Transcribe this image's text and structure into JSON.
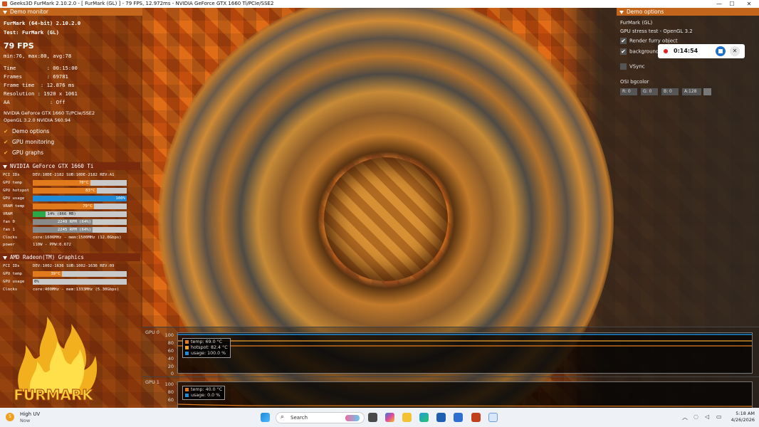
{
  "window": {
    "title": "Geeks3D FurMark 2.10.2.0 - [ FurMark (GL) ] - 79 FPS, 12.972ms - NVIDIA GeForce GTX 1660 Ti/PCIe/SSE2",
    "controls": [
      "—",
      "☐",
      "✕"
    ]
  },
  "demo_monitor": {
    "header": "Demo monitor",
    "app_line": "FurMark (64-bit) 2.10.2.0",
    "test_line": "Test: FurMark (GL)",
    "fps": "79 FPS",
    "minmax": "min:76, max:80, avg:78",
    "stats": [
      "Time          : 00:15:00",
      "Frames        : 69781",
      "Frame time  : 12.876 ms",
      "Resolution : 1920 x 1061",
      "AA             : Off"
    ],
    "gpu_name": "NVIDIA GeForce GTX 1660 Ti/PCIe/SSE2",
    "opengl": "OpenGL 3.2.0 NVIDIA 560.94",
    "checks": [
      "Demo options",
      "GPU monitoring",
      "GPU graphs"
    ]
  },
  "gpu0": {
    "header": "NVIDIA GeForce GTX 1660 Ti",
    "pci_label": "PCI IDs",
    "pci_value": "DEV:10DE-2182 SUB:10DE-2182 REV:A1",
    "bars": [
      {
        "label": "GPU temp",
        "text": "70°C",
        "percent": 61,
        "color": "#e07a1c"
      },
      {
        "label": "GPU hotspot",
        "text": "83°C",
        "percent": 68,
        "color": "#e07a1c"
      },
      {
        "label": "GPU usage",
        "text": "100%",
        "percent": 100,
        "color": "#1f8ad6"
      },
      {
        "label": "VRAM temp",
        "text": "79°C",
        "percent": 65,
        "color": "#e07a1c"
      },
      {
        "label": "VRAM",
        "text": "14% (866 MB)",
        "percent": 14,
        "color": "#2aa84a"
      },
      {
        "label": "fan 0",
        "text": "2249 RPM (64%)",
        "percent": 64,
        "color": "#8a8a8a"
      },
      {
        "label": "fan 1",
        "text": "2245 RPM (64%)",
        "percent": 64,
        "color": "#8a8a8a"
      }
    ],
    "clocks_label": "Clocks",
    "clocks_value": "core:1606MHz - mem:1500MHz (12.0Gbps)",
    "power_label": "power",
    "power_value": "110W - PPW:0.672"
  },
  "gpu1": {
    "header": "AMD Radeon(TM) Graphics",
    "pci_label": "PCI IDs",
    "pci_value": "DEV:1002-1636 SUB:1002-1636 REV:09",
    "bars": [
      {
        "label": "GPU temp",
        "text": "39°C",
        "percent": 31,
        "color": "#e07a1c"
      },
      {
        "label": "GPU usage",
        "text": "0%",
        "percent": 0,
        "color": "#1f8ad6"
      }
    ],
    "clocks_label": "Clocks",
    "clocks_value": "core:400MHz - mem:1333MHz (5.30Gbps)"
  },
  "logo_text": "FURMARK",
  "demo_options": {
    "header": "Demo options",
    "title": "FurMark (GL)",
    "subtitle": "GPU stress test - OpenGL 3.2",
    "render_furry": "Render furry object",
    "background": "background",
    "vsync": "VSync",
    "osi_label": "OSI bgcolor",
    "chips": [
      "R: 0",
      "G: 0",
      "B: 0",
      "A:128"
    ]
  },
  "recording": {
    "time": "0:14:54",
    "mic_icon": "mic-off-icon"
  },
  "graphs": {
    "gpu0": {
      "name": "GPU 0",
      "ticks": [
        "100",
        "80",
        "60",
        "40",
        "20",
        "0"
      ],
      "legend": [
        {
          "text": "temp: 69.0 °C",
          "color": "#e07a1c"
        },
        {
          "text": "hotspot: 82.4 °C",
          "color": "#f0a030"
        },
        {
          "text": "usage: 100.0 %",
          "color": "#1f8ad6"
        }
      ]
    },
    "gpu1": {
      "name": "GPU 1",
      "ticks": [
        "100",
        "80",
        "60"
      ],
      "legend": [
        {
          "text": "temp: 40.0 °C",
          "color": "#e07a1c"
        },
        {
          "text": "usage: 0.0 %",
          "color": "#1f8ad6"
        }
      ]
    }
  },
  "taskbar": {
    "weather_title": "High UV",
    "weather_sub": "Now",
    "weather_badge": "5",
    "search_placeholder": "Search",
    "time": "5:18 AM",
    "date": "4/26/2026"
  }
}
